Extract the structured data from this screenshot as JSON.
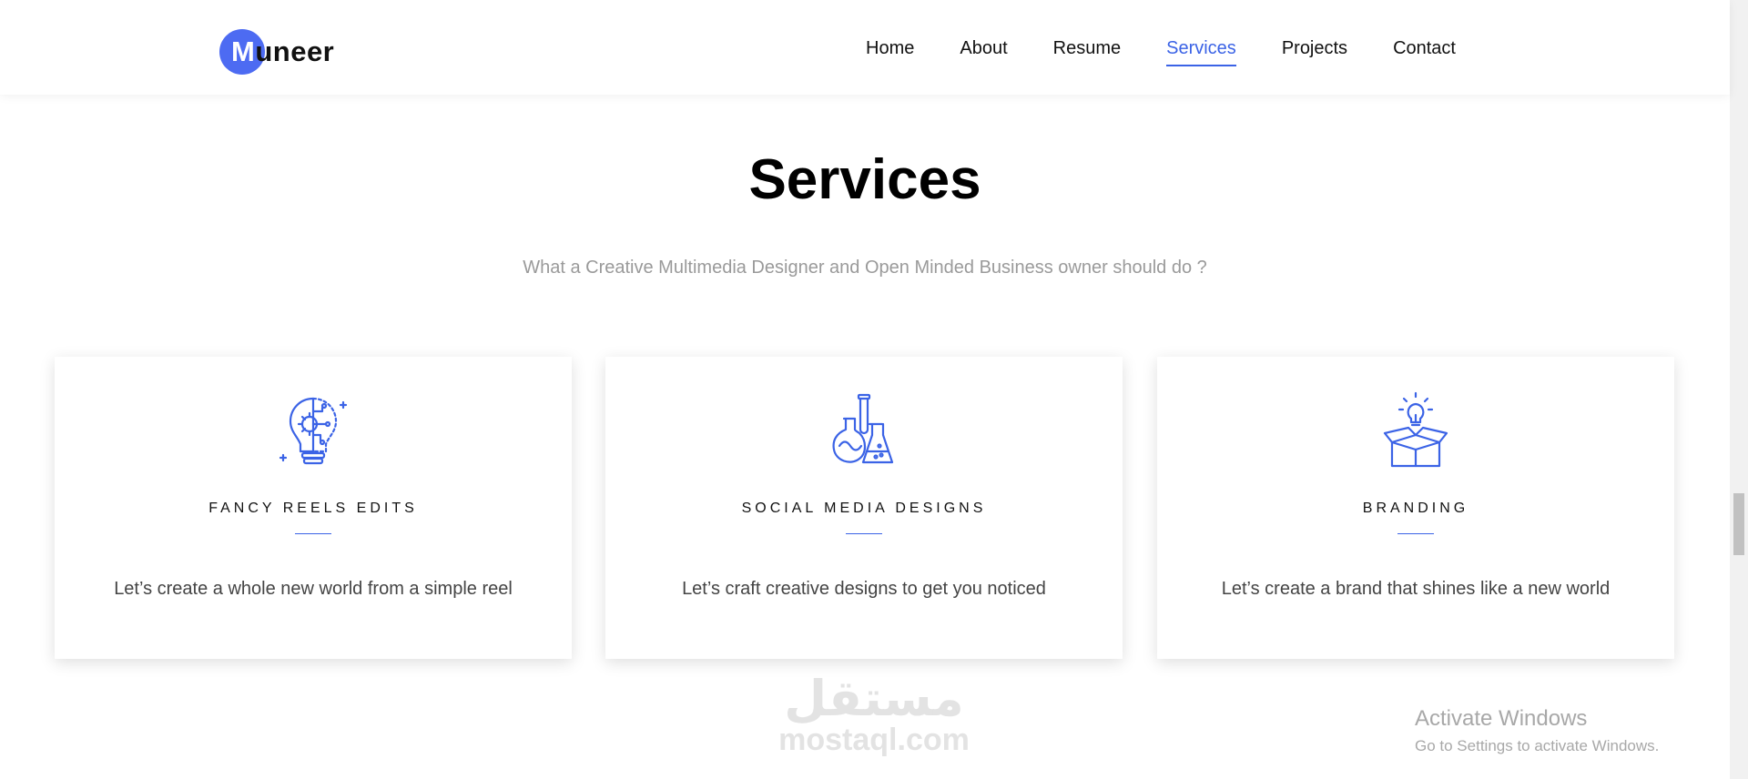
{
  "header": {
    "logo_first_letter": "M",
    "logo_rest": "uneer",
    "nav": [
      {
        "label": "Home"
      },
      {
        "label": "About"
      },
      {
        "label": "Resume"
      },
      {
        "label": "Services",
        "active": true
      },
      {
        "label": "Projects"
      },
      {
        "label": "Contact"
      }
    ]
  },
  "section": {
    "title": "Services",
    "subtitle": "What a Creative Multimedia Designer and Open Minded Business owner should do ?"
  },
  "cards": [
    {
      "icon": "bulb-gear-icon",
      "title": "FANCY REELS EDITS",
      "text": "Let’s create a whole new world from a simple reel"
    },
    {
      "icon": "lab-flasks-icon",
      "title": "SOCIAL MEDIA DESIGNS",
      "text": "Let’s craft creative designs to get you noticed"
    },
    {
      "icon": "box-idea-icon",
      "title": "BRANDING",
      "text": "Let’s create a brand that shines like a new world"
    }
  ],
  "watermark": {
    "arabic": "مستقل",
    "latin": "mostaql.com"
  },
  "os_notice": {
    "title": "Activate Windows",
    "subtitle": "Go to Settings to activate Windows."
  },
  "colors": {
    "accent": "#3b63e6",
    "logo_circle": "#4d6bf2"
  }
}
